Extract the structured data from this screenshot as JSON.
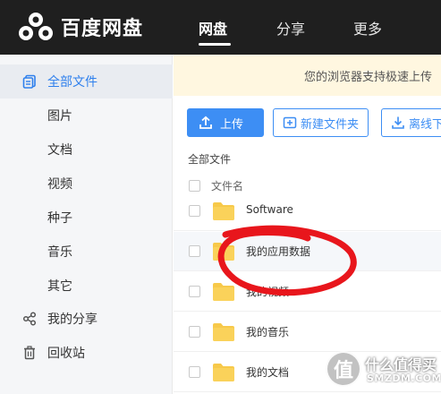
{
  "header": {
    "brand": "百度网盘",
    "nav": [
      {
        "label": "网盘",
        "active": true
      },
      {
        "label": "分享",
        "active": false
      },
      {
        "label": "更多",
        "active": false
      }
    ]
  },
  "sidebar": {
    "items": [
      {
        "label": "全部文件",
        "icon": "all-files-icon",
        "active": true
      },
      {
        "label": "图片"
      },
      {
        "label": "文档"
      },
      {
        "label": "视频"
      },
      {
        "label": "种子"
      },
      {
        "label": "音乐"
      },
      {
        "label": "其它"
      },
      {
        "label": "我的分享",
        "icon": "share-icon"
      },
      {
        "label": "回收站",
        "icon": "trash-icon"
      }
    ]
  },
  "notice": {
    "text": "您的浏览器支持极速上传"
  },
  "toolbar": {
    "upload_label": "上传",
    "new_folder_label": "新建文件夹",
    "offline_label": "离线下载"
  },
  "breadcrumb": "全部文件",
  "file_list": {
    "column_name": "文件名",
    "rows": [
      {
        "name": "Software"
      },
      {
        "name": "我的应用数据"
      },
      {
        "name": "我的视频"
      },
      {
        "name": "我的音乐"
      },
      {
        "name": "我的文档"
      }
    ]
  },
  "watermark": {
    "logo": "值",
    "title": "什么值得买",
    "subtitle": "SMZDM.COM"
  },
  "colors": {
    "accent": "#3d8ef4",
    "topbar": "#1f1f1f",
    "folder": "#f7c94a",
    "annotation": "#e8161c"
  }
}
